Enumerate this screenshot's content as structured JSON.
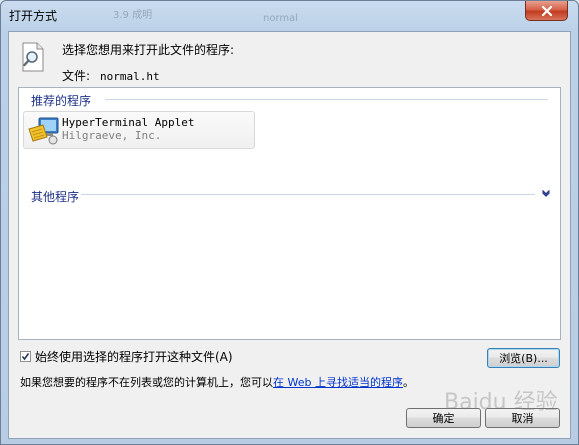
{
  "window": {
    "title": "打开方式",
    "bg_ghost_1": "3.9 成明",
    "bg_ghost_2": "normal"
  },
  "dialog": {
    "prompt": "选择您想用来打开此文件的程序:",
    "file_label": "文件:",
    "file_name": "normal.ht"
  },
  "programs": {
    "recommended_header": "推荐的程序",
    "other_header": "其他程序",
    "items": [
      {
        "name": "HyperTerminal Applet",
        "vendor": "Hilgraeve, Inc.",
        "icon": "hyperterminal-icon"
      }
    ]
  },
  "options": {
    "always_use_label": "始终使用选择的程序打开这种文件(A)",
    "always_use_checked": true
  },
  "buttons": {
    "browse": "浏览(B)...",
    "ok": "确定",
    "cancel": "取消"
  },
  "hint": {
    "prefix": "如果您想要的程序不在列表或您的计算机上，您可以",
    "link": "在 Web 上寻找适当的程序",
    "suffix": "。"
  },
  "watermark": {
    "text": "Baidu 经验"
  },
  "colors": {
    "group_header": "#1e3287",
    "link": "#0033cc",
    "close_button": "#c23b20"
  }
}
